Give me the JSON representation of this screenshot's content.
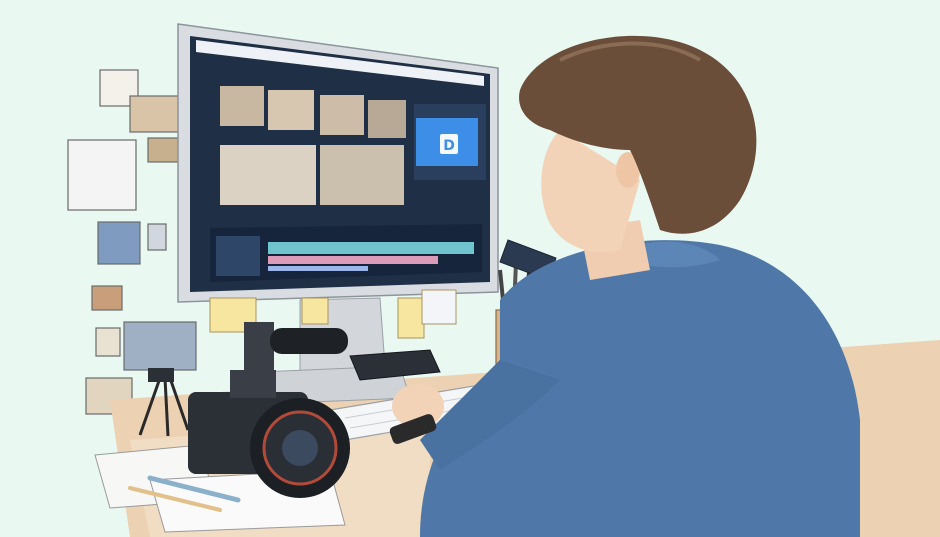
{
  "scene": {
    "description_alt": "",
    "colors": {
      "background": "#e9f8f1",
      "monitor_frame": "#d9dde2",
      "screen_dark": "#1f2f46",
      "accent_blue": "#3d8ee6",
      "timeline_cyan": "#7fe0e8",
      "shirt_blue": "#4f78a8",
      "hair_brown": "#6a4e3a",
      "skin": "#f3d3b8",
      "desk_wood": "#e9c9a6",
      "camera_black": "#2b2f36",
      "sticky_yellow": "#f6e6a0"
    },
    "panel_logo_letter": "D"
  }
}
